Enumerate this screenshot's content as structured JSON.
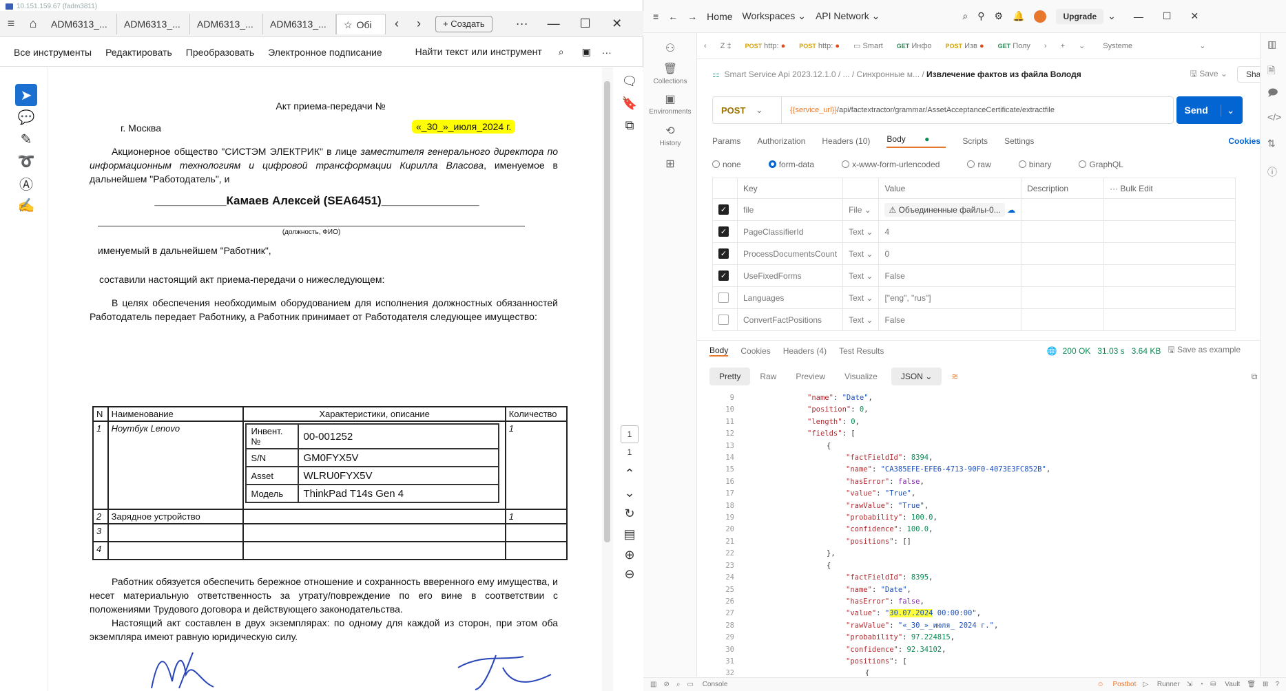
{
  "rdp": {
    "title": "10.151.159.67 (fadm3811)"
  },
  "viewer": {
    "tabs": [
      "ADM6313_...",
      "ADM6313_...",
      "ADM6313_...",
      "ADM6313_...",
      "Обі"
    ],
    "create_label": "Создать",
    "menu": [
      "Все инструменты",
      "Редактировать",
      "Преобразовать",
      "Электронное подписание"
    ],
    "search_label": "Найти текст или инструмент",
    "page_numbers": [
      "1",
      "1"
    ]
  },
  "doc": {
    "title": "Акт приема-передачи №",
    "city": "г. Москва",
    "date": "«_30_»_июля_2024 г.",
    "para1_a": "Акционерное общество \"СИСТЭМ ЭЛЕКТРИК\" в лице ",
    "para1_b": "заместителя генерального директора по информационным технологиям и цифровой трансформации Кирилла Власова",
    "para1_c": ", именуемое в дальнейшем \"Работодатель\", и",
    "employee": "___________Камаев Алексей (SEA6451)_______________",
    "position_hint": "(должность, ФИО)",
    "named_worker": "именуемый в дальнейшем \"Работник\",",
    "compiled": "составили настоящий акт приема-передачи о нижеследующем:",
    "para2": "В целях обеспечения необходимым оборудованием для исполнения должностных обязанностей Работодатель передает Работнику, а Работник принимает от Работодателя следующее имущество:",
    "table_headers": [
      "N",
      "Наименование",
      "Характеристики, описание",
      "Количество"
    ],
    "row1": {
      "n": "1",
      "name": "Ноутбук Lenovo",
      "qty": "1",
      "specs": [
        [
          "Инвент. №",
          "00-001252"
        ],
        [
          "S/N",
          "GM0FYX5V"
        ],
        [
          "Asset",
          "WLRU0FYX5V"
        ],
        [
          "Модель",
          "ThinkPad T14s Gen 4"
        ]
      ]
    },
    "row2": {
      "n": "2",
      "name": "Зарядное устройство",
      "qty": "1"
    },
    "row3": {
      "n": "3"
    },
    "row4": {
      "n": "4"
    },
    "para3": "Работник обязуется обеспечить бережное отношение и сохранность вверенного ему имущества, и несет материальную ответственность за утрату/повреждение по его вине в соответствии с положениями Трудового договора и действующего законодательства.",
    "para4": "Настоящий акт составлен в двух экземплярах: по одному для каждой из сторон, при этом оба экземпляра имеют равную юридическую силу."
  },
  "postman": {
    "nav": [
      "Home",
      "Workspaces",
      "API Network"
    ],
    "upgrade": "Upgrade",
    "sidebar": [
      "Collections",
      "Environments",
      "History"
    ],
    "req_tabs": [
      {
        "method": "POST",
        "label": "http:"
      },
      {
        "method": "POST",
        "label": "http:"
      },
      {
        "method": "",
        "label": "Smart"
      },
      {
        "method": "GET",
        "label": "Инфо"
      },
      {
        "method": "POST",
        "label": "Изв"
      },
      {
        "method": "GET",
        "label": "Полу"
      }
    ],
    "zeta": "Z ‡",
    "env": "Systeme",
    "breadcrumb": {
      "root": "Smart Service Api 2023.12.1.0",
      "sep": "/ ... / Синхронные м... /",
      "current": "Извлечение фактов из файла Володя"
    },
    "save": "Save",
    "share": "Share",
    "method": "POST",
    "url_var": "{{service_url}}",
    "url_path": "/api/factextractor/grammar/AssetAcceptanceCertificate/extractfile",
    "send": "Send",
    "tabs": [
      "Params",
      "Authorization",
      "Headers (10)",
      "Body",
      "Scripts",
      "Settings"
    ],
    "cookies": "Cookies",
    "body_types": [
      "none",
      "form-data",
      "x-www-form-urlencoded",
      "raw",
      "binary",
      "GraphQL"
    ],
    "table_head": [
      "Key",
      "Value",
      "Description",
      "Bulk Edit"
    ],
    "rows": [
      {
        "key": "file",
        "type": "File",
        "value": "⚠ Объединенные файлы-0...",
        "checked": true
      },
      {
        "key": "PageClassifierId",
        "type": "Text",
        "value": "4",
        "checked": true
      },
      {
        "key": "ProcessDocumentsCount",
        "type": "Text",
        "value": "0",
        "checked": true
      },
      {
        "key": "UseFixedForms",
        "type": "Text",
        "value": "False",
        "checked": true
      },
      {
        "key": "Languages",
        "type": "Text",
        "value": "[\"eng\", \"rus\"]",
        "checked": false
      },
      {
        "key": "ConvertFactPositions",
        "type": "Text",
        "value": "False",
        "checked": false
      }
    ],
    "res_tabs": [
      "Body",
      "Cookies",
      "Headers (4)",
      "Test Results"
    ],
    "status": "200 OK",
    "time": "31.03 s",
    "size": "3.64 KB",
    "save_example": "Save as example",
    "views": [
      "Pretty",
      "Raw",
      "Preview",
      "Visualize"
    ],
    "format": "JSON",
    "status_items": [
      "Console",
      "Postbot",
      "Runner",
      "Vault"
    ],
    "code_lines": [
      {
        "n": "9",
        "ind": 6,
        "html": "<span class='k'>\"name\"</span>: <span class='s'>\"Date\"</span>,"
      },
      {
        "n": "10",
        "ind": 6,
        "html": "<span class='k'>\"position\"</span>: <span class='n'>0</span>,"
      },
      {
        "n": "11",
        "ind": 6,
        "html": "<span class='k'>\"length\"</span>: <span class='n'>0</span>,"
      },
      {
        "n": "12",
        "ind": 6,
        "html": "<span class='k'>\"fields\"</span>: ["
      },
      {
        "n": "13",
        "ind": 8,
        "html": "{"
      },
      {
        "n": "14",
        "ind": 10,
        "html": "<span class='k'>\"factFieldId\"</span>: <span class='n'>8394</span>,"
      },
      {
        "n": "15",
        "ind": 10,
        "html": "<span class='k'>\"name\"</span>: <span class='s'>\"CA385EFE-EFE6-4713-90F0-4073E3FC852B\"</span>,"
      },
      {
        "n": "16",
        "ind": 10,
        "html": "<span class='k'>\"hasError\"</span>: <span class='b'>false</span>,"
      },
      {
        "n": "17",
        "ind": 10,
        "html": "<span class='k'>\"value\"</span>: <span class='s'>\"True\"</span>,"
      },
      {
        "n": "18",
        "ind": 10,
        "html": "<span class='k'>\"rawValue\"</span>: <span class='s'>\"True\"</span>,"
      },
      {
        "n": "19",
        "ind": 10,
        "html": "<span class='k'>\"probability\"</span>: <span class='n'>100.0</span>,"
      },
      {
        "n": "20",
        "ind": 10,
        "html": "<span class='k'>\"confidence\"</span>: <span class='n'>100.0</span>,"
      },
      {
        "n": "21",
        "ind": 10,
        "html": "<span class='k'>\"positions\"</span>: []"
      },
      {
        "n": "22",
        "ind": 8,
        "html": "},"
      },
      {
        "n": "23",
        "ind": 8,
        "html": "{"
      },
      {
        "n": "24",
        "ind": 10,
        "html": "<span class='k'>\"factFieldId\"</span>: <span class='n'>8395</span>,"
      },
      {
        "n": "25",
        "ind": 10,
        "html": "<span class='k'>\"name\"</span>: <span class='s'>\"Date\"</span>,"
      },
      {
        "n": "26",
        "ind": 10,
        "html": "<span class='k'>\"hasError\"</span>: <span class='b'>false</span>,"
      },
      {
        "n": "27",
        "ind": 10,
        "html": "<span class='k'>\"value\"</span>: <span class='s'>\"<span class='hly'>30.07.2024</span> 00:00:00\"</span>,"
      },
      {
        "n": "28",
        "ind": 10,
        "html": "<span class='k'>\"rawValue\"</span>: <span class='s'>\"«_30_»_июля_ 2024 г.\"</span>,"
      },
      {
        "n": "29",
        "ind": 10,
        "html": "<span class='k'>\"probability\"</span>: <span class='n'>97.224815</span>,"
      },
      {
        "n": "30",
        "ind": 10,
        "html": "<span class='k'>\"confidence\"</span>: <span class='n'>92.34102</span>,"
      },
      {
        "n": "31",
        "ind": 10,
        "html": "<span class='k'>\"positions\"</span>: ["
      },
      {
        "n": "32",
        "ind": 12,
        "html": "{"
      }
    ]
  }
}
